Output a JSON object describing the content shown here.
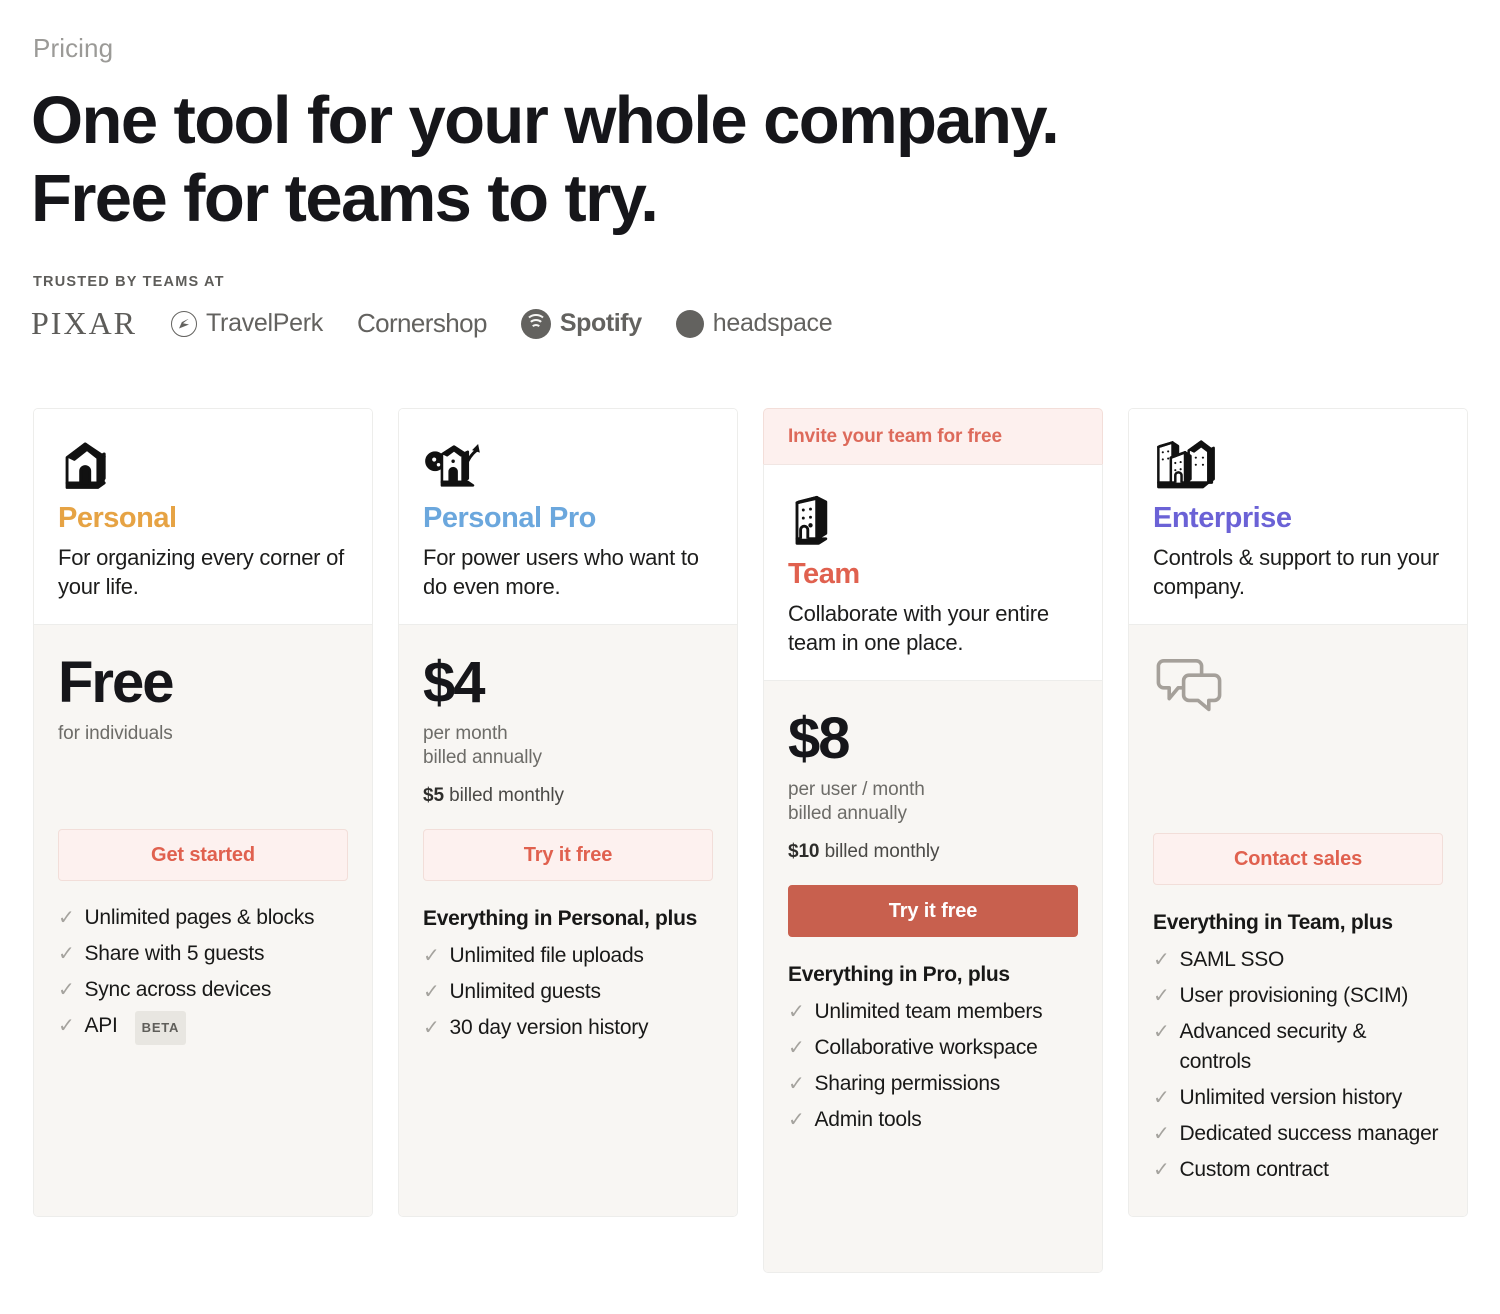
{
  "header": {
    "eyebrow": "Pricing",
    "headline_line1": "One tool for your whole company.",
    "headline_line2": "Free for teams to try.",
    "trusted_label": "TRUSTED BY TEAMS AT",
    "logos": [
      {
        "name": "PIXAR",
        "mark": "none"
      },
      {
        "name": "TravelPerk",
        "mark": "travelperk-balloon"
      },
      {
        "name": "Cornershop",
        "mark": "none"
      },
      {
        "name": "Spotify",
        "mark": "spotify-waves"
      },
      {
        "name": "headspace",
        "mark": "circle"
      }
    ]
  },
  "colors": {
    "personal": "#e6a344",
    "personal_pro": "#6ba7dd",
    "team": "#e0614f",
    "enterprise": "#6b62d6",
    "cta_text": "#e0614f",
    "cta_solid_bg": "#c8604e",
    "banner_bg": "#fdf0ee",
    "card_bottom_bg": "#f8f6f3"
  },
  "plans": [
    {
      "id": "personal",
      "banner": null,
      "icon": "house-icon",
      "name": "Personal",
      "name_color": "#e6a344",
      "description": "For organizing every corner of your life.",
      "price": "Free",
      "price_note": "for individuals",
      "price_alt_bold": "",
      "price_alt_rest": "",
      "cta_label": "Get started",
      "cta_style": "outline",
      "feature_head": "",
      "features": [
        {
          "label": "Unlimited pages & blocks",
          "badge": ""
        },
        {
          "label": "Share with 5 guests",
          "badge": ""
        },
        {
          "label": "Sync across devices",
          "badge": ""
        },
        {
          "label": "API",
          "badge": "BETA"
        }
      ]
    },
    {
      "id": "personal-pro",
      "banner": null,
      "icon": "house-plant-icon",
      "name": "Personal Pro",
      "name_color": "#6ba7dd",
      "description": "For power users who want to do even more.",
      "price": "$4",
      "price_note": "per month\nbilled annually",
      "price_alt_bold": "$5",
      "price_alt_rest": " billed monthly",
      "cta_label": "Try it free",
      "cta_style": "outline",
      "feature_head": "Everything in Personal, plus",
      "features": [
        {
          "label": "Unlimited file uploads",
          "badge": ""
        },
        {
          "label": "Unlimited guests",
          "badge": ""
        },
        {
          "label": "30 day version history",
          "badge": ""
        }
      ]
    },
    {
      "id": "team",
      "banner": "Invite your team for free",
      "icon": "office-building-icon",
      "name": "Team",
      "name_color": "#e0614f",
      "description": "Collaborate with your entire team in one place.",
      "price": "$8",
      "price_note": "per user / month\nbilled annually",
      "price_alt_bold": "$10",
      "price_alt_rest": " billed monthly",
      "cta_label": "Try it free",
      "cta_style": "solid",
      "feature_head": "Everything in Pro, plus",
      "features": [
        {
          "label": "Unlimited team members",
          "badge": ""
        },
        {
          "label": "Collaborative workspace",
          "badge": ""
        },
        {
          "label": "Sharing permissions",
          "badge": ""
        },
        {
          "label": "Admin tools",
          "badge": ""
        }
      ]
    },
    {
      "id": "enterprise",
      "banner": null,
      "icon": "city-buildings-icon",
      "name": "Enterprise",
      "name_color": "#6b62d6",
      "description": "Controls & support to run your company.",
      "price": "",
      "price_note": "",
      "price_alt_bold": "",
      "price_alt_rest": "",
      "price_icon": "chat-bubbles-icon",
      "cta_label": "Contact sales",
      "cta_style": "outline",
      "feature_head": "Everything in Team, plus",
      "features": [
        {
          "label": "SAML SSO",
          "badge": ""
        },
        {
          "label": "User provisioning (SCIM)",
          "badge": ""
        },
        {
          "label": "Advanced security & controls",
          "badge": ""
        },
        {
          "label": "Unlimited version history",
          "badge": ""
        },
        {
          "label": "Dedicated success manager",
          "badge": ""
        },
        {
          "label": "Custom contract",
          "badge": ""
        }
      ]
    }
  ]
}
